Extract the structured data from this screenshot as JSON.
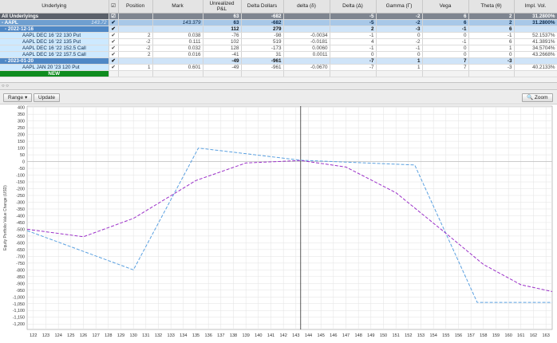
{
  "columns": [
    "Underlying",
    "",
    "Position",
    "Mark",
    "Unrealized P&L",
    "Delta Dollars",
    "delta (δ)",
    "Delta (Δ)",
    "Gamma (Γ)",
    "Vega",
    "Theta (θ)",
    "Impl. Vol."
  ],
  "rows": [
    {
      "type": "all",
      "name": "All Underlyings",
      "check": "☑",
      "position": "",
      "mark": "",
      "upl": "63",
      "dd": "-682",
      "delta_small": "",
      "delta": "-5",
      "gamma": "-2",
      "vega": "6",
      "theta": "2",
      "iv": "31.2800%"
    },
    {
      "type": "aapl",
      "name": "- AAPL",
      "name_suffix": "143.72",
      "check": "✔",
      "position": "",
      "mark": "143.379",
      "upl": "63",
      "dd": "-682",
      "delta_small": "",
      "delta": "-5",
      "gamma": "-2",
      "vega": "6",
      "theta": "2",
      "iv": "31.2800%"
    },
    {
      "type": "exp",
      "name": "- 2022-12-16",
      "check": "✔",
      "position": "",
      "mark": "",
      "upl": "112",
      "dd": "279",
      "delta_small": "",
      "delta": "2",
      "gamma": "-3",
      "vega": "-1",
      "theta": "6",
      "iv": ""
    },
    {
      "type": "leg",
      "name": "AAPL DEC 16 '22 130 Put",
      "check": "✔",
      "position": "2",
      "mark": "0.038",
      "upl": "-76",
      "dd": "-98",
      "delta_small": "-0.0034",
      "delta": "-1",
      "gamma": "0",
      "vega": "0",
      "theta": "-1",
      "iv": "52.1537%"
    },
    {
      "type": "leg",
      "name": "AAPL DEC 16 '22 135 Put",
      "check": "✔",
      "position": "-2",
      "mark": "0.111",
      "upl": "102",
      "dd": "519",
      "delta_small": "-0.0181",
      "delta": "4",
      "gamma": "-2",
      "vega": "-1",
      "theta": "6",
      "iv": "41.3891%"
    },
    {
      "type": "leg",
      "name": "AAPL DEC 16 '22 152.5 Call",
      "check": "✔",
      "position": "-2",
      "mark": "0.032",
      "upl": "128",
      "dd": "-173",
      "delta_small": "0.0060",
      "delta": "-1",
      "gamma": "-1",
      "vega": "0",
      "theta": "1",
      "iv": "34.5704%"
    },
    {
      "type": "leg",
      "name": "AAPL DEC 16 '22 157.5 Call",
      "check": "✔",
      "position": "2",
      "mark": "0.016",
      "upl": "-41",
      "dd": "31",
      "delta_small": "0.0011",
      "delta": "0",
      "gamma": "0",
      "vega": "0",
      "theta": "0",
      "iv": "43.2668%"
    },
    {
      "type": "exp",
      "name": "- 2023-01-20",
      "check": "✔",
      "position": "",
      "mark": "",
      "upl": "-49",
      "dd": "-961",
      "delta_small": "",
      "delta": "-7",
      "gamma": "1",
      "vega": "7",
      "theta": "-3",
      "iv": ""
    },
    {
      "type": "leg",
      "name": "AAPL JAN 20 '23 120 Put",
      "check": "✔",
      "position": "1",
      "mark": "0.601",
      "upl": "-49",
      "dd": "-961",
      "delta_small": "-0.0670",
      "delta": "-7",
      "gamma": "1",
      "vega": "7",
      "theta": "-3",
      "iv": "40.2133%"
    },
    {
      "type": "new",
      "name": "NEW",
      "check": "",
      "position": "",
      "mark": "",
      "upl": "",
      "dd": "",
      "delta_small": "",
      "delta": "",
      "gamma": "",
      "vega": "",
      "theta": "",
      "iv": ""
    }
  ],
  "splitter_label": "○ ○",
  "toolbar": {
    "range_label": "Range ▾",
    "update_label": "Update",
    "zoom_label": "🔍 Zoom"
  },
  "chart_data": {
    "type": "line",
    "ylabel": "Equity Portfolio Value Change (USD)",
    "xlabel": "",
    "x_ticks": [
      122,
      123,
      124,
      125,
      126,
      127,
      128,
      129,
      130,
      131,
      132,
      133,
      134,
      135,
      136,
      137,
      138,
      139,
      140,
      141,
      142,
      143,
      144,
      145,
      146,
      147,
      148,
      149,
      150,
      151,
      152,
      153,
      154,
      155,
      156,
      157,
      158,
      159,
      160,
      161,
      162,
      163
    ],
    "y_ticks": [
      400,
      350,
      300,
      250,
      200,
      150,
      100,
      50,
      0,
      -50,
      -100,
      -150,
      -200,
      -250,
      -300,
      -350,
      -400,
      -450,
      -500,
      -550,
      -600,
      -650,
      -700,
      -750,
      -800,
      -850,
      -900,
      -950,
      -1000,
      -1050,
      -1100,
      -1150,
      -1200
    ],
    "xlim": [
      121.5,
      163.5
    ],
    "ylim": [
      -1240,
      410
    ],
    "current_price": 143.379,
    "grid": true,
    "series": [
      {
        "color": "#5aa0e0",
        "style": "dashed",
        "x": [
          121.5,
          130,
          135.2,
          143.4,
          152.5,
          157.5,
          163.5
        ],
        "y": [
          -510,
          -800,
          100,
          10,
          -25,
          -1040,
          -1040
        ]
      },
      {
        "color": "#9b30c8",
        "style": "dashed",
        "x": [
          121.5,
          126,
          130,
          135,
          139,
          143.4,
          147,
          151,
          155,
          158,
          161,
          163.5
        ],
        "y": [
          -500,
          -555,
          -420,
          -140,
          -10,
          8,
          -40,
          -230,
          -530,
          -760,
          -910,
          -960
        ]
      }
    ]
  }
}
